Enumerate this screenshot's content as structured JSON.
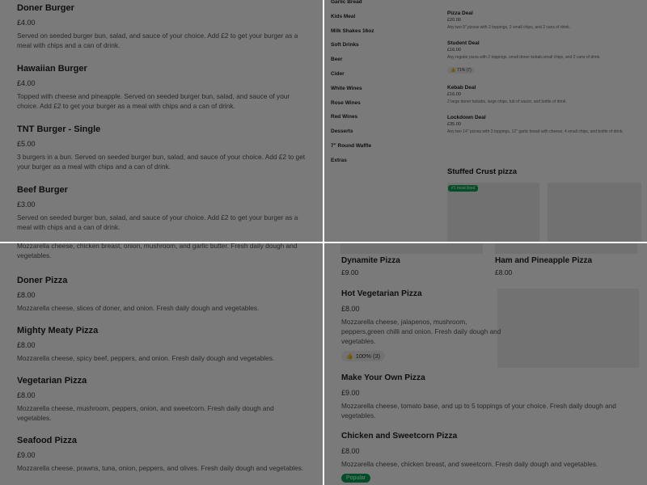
{
  "burgers": [
    {
      "name": "Doner Burger",
      "price": "£4.00",
      "desc": "Served on seeded burger bun, salad, and sauce of your choice. Add £2 to get your burger as a meal with chips and a can of drink."
    },
    {
      "name": "Hawaiian Burger",
      "price": "£4.00",
      "desc": "Topped with cheese and pineapple. Served on seeded burger bun, salad, and sauce of your choice. Add £2 to get your burger as a meal with chips and a can of drink."
    },
    {
      "name": "TNT Burger - Single",
      "price": "£5.00",
      "desc": "3 burgers in a bun. Served on seeded burger bun, salad, and sauce of your choice. Add £2 to get your burger as a meal with chips and a can of drink."
    },
    {
      "name": "Beef Burger",
      "price": "£3.00",
      "desc": "Served on seeded burger bun, salad, and sauce of your choice. Add £2 to get your burger as a meal with chips and a can of drink."
    }
  ],
  "categories": [
    "Garlic Bread",
    "Kids Meal",
    "Milk Shakes 16oz",
    "Soft Drinks",
    "Beer",
    "Cider",
    "White Wines",
    "Rose Wines",
    "Red Wines",
    "Desserts",
    "7\" Round Waffle",
    "Extras"
  ],
  "deals": [
    {
      "name": "Pizza Deal",
      "price": "£20.00",
      "desc": "Any two 9\" pizzas with 2 toppings, 2 small chips, and 2 cans of drink.",
      "rating": ""
    },
    {
      "name": "Student Deal",
      "price": "£16.00",
      "desc": "Any regular pizza with 2 toppings, small doner kebab,small chips, and 2 cans of drink.",
      "rating": "71% (7)"
    },
    {
      "name": "Kebab Deal",
      "price": "£16.00",
      "desc": "2 large doner kebabs, large chips, tub of sauce, and bottle of drink.",
      "rating": ""
    },
    {
      "name": "Lockdown Deal",
      "price": "£35.00",
      "desc": "Any two 14\" pizzas with 3 toppings, 12\" garlic bread with cheese, 4 small chips, and bottle of drink.",
      "rating": ""
    }
  ],
  "stuffed_crust": {
    "title": "Stuffed Crust pizza",
    "badge": "#1 most liked"
  },
  "pizzas_left": {
    "top_desc": "Mozzarella cheese, chicken breast, onion, mushroom, and garlic butter. Fresh daily dough and vegetables.",
    "items": [
      {
        "name": "Doner Pizza",
        "price": "£8.00",
        "desc": "Mozzarella cheese, slices of doner, and onion. Fresh daily dough and vegetables."
      },
      {
        "name": "Mighty Meaty Pizza",
        "price": "£8.00",
        "desc": "Mozzarella cheese, spicy beef, peppers, and onion. Fresh daily dough and vegetables."
      },
      {
        "name": "Vegetarian Pizza",
        "price": "£8.00",
        "desc": "Mozzarella cheese, mushroom, peppers, onion, and sweetcorn. Fresh daily dough and vegetables."
      },
      {
        "name": "Seafood Pizza",
        "price": "£9.00",
        "desc": "Mozzarella cheese, prawns, tuna, onion, peppers, and olives. Fresh daily dough and vegetables."
      }
    ]
  },
  "pizzas_right": {
    "cards": [
      {
        "name": "Dynamite Pizza",
        "price": "£9.00"
      },
      {
        "name": "Ham and Pineapple Pizza",
        "price": "£8.00"
      }
    ],
    "items": [
      {
        "name": "Hot Vegetarian Pizza",
        "price": "£8.00",
        "desc": "Mozzarella cheese, jalapenos, mushroom, peppers,green chilli and onion. Fresh daily dough and vegetables.",
        "rating": "100% (3)"
      },
      {
        "name": "Make Your Own Pizza",
        "price": "£9.00",
        "desc": "Mozzarella cheese, tomato base, and up to 5 toppings of your choice. Fresh daily dough and vegetables."
      },
      {
        "name": "Chicken and Sweetcorn Pizza",
        "price": "£8.00",
        "desc": "Mozzarella cheese, chicken breast, and sweetcorn. Fresh daily dough and vegetables.",
        "badge": "Popular"
      }
    ]
  },
  "colors": {
    "accent": "#05a357",
    "overlay": "rgba(0,0,0,0.52)"
  }
}
